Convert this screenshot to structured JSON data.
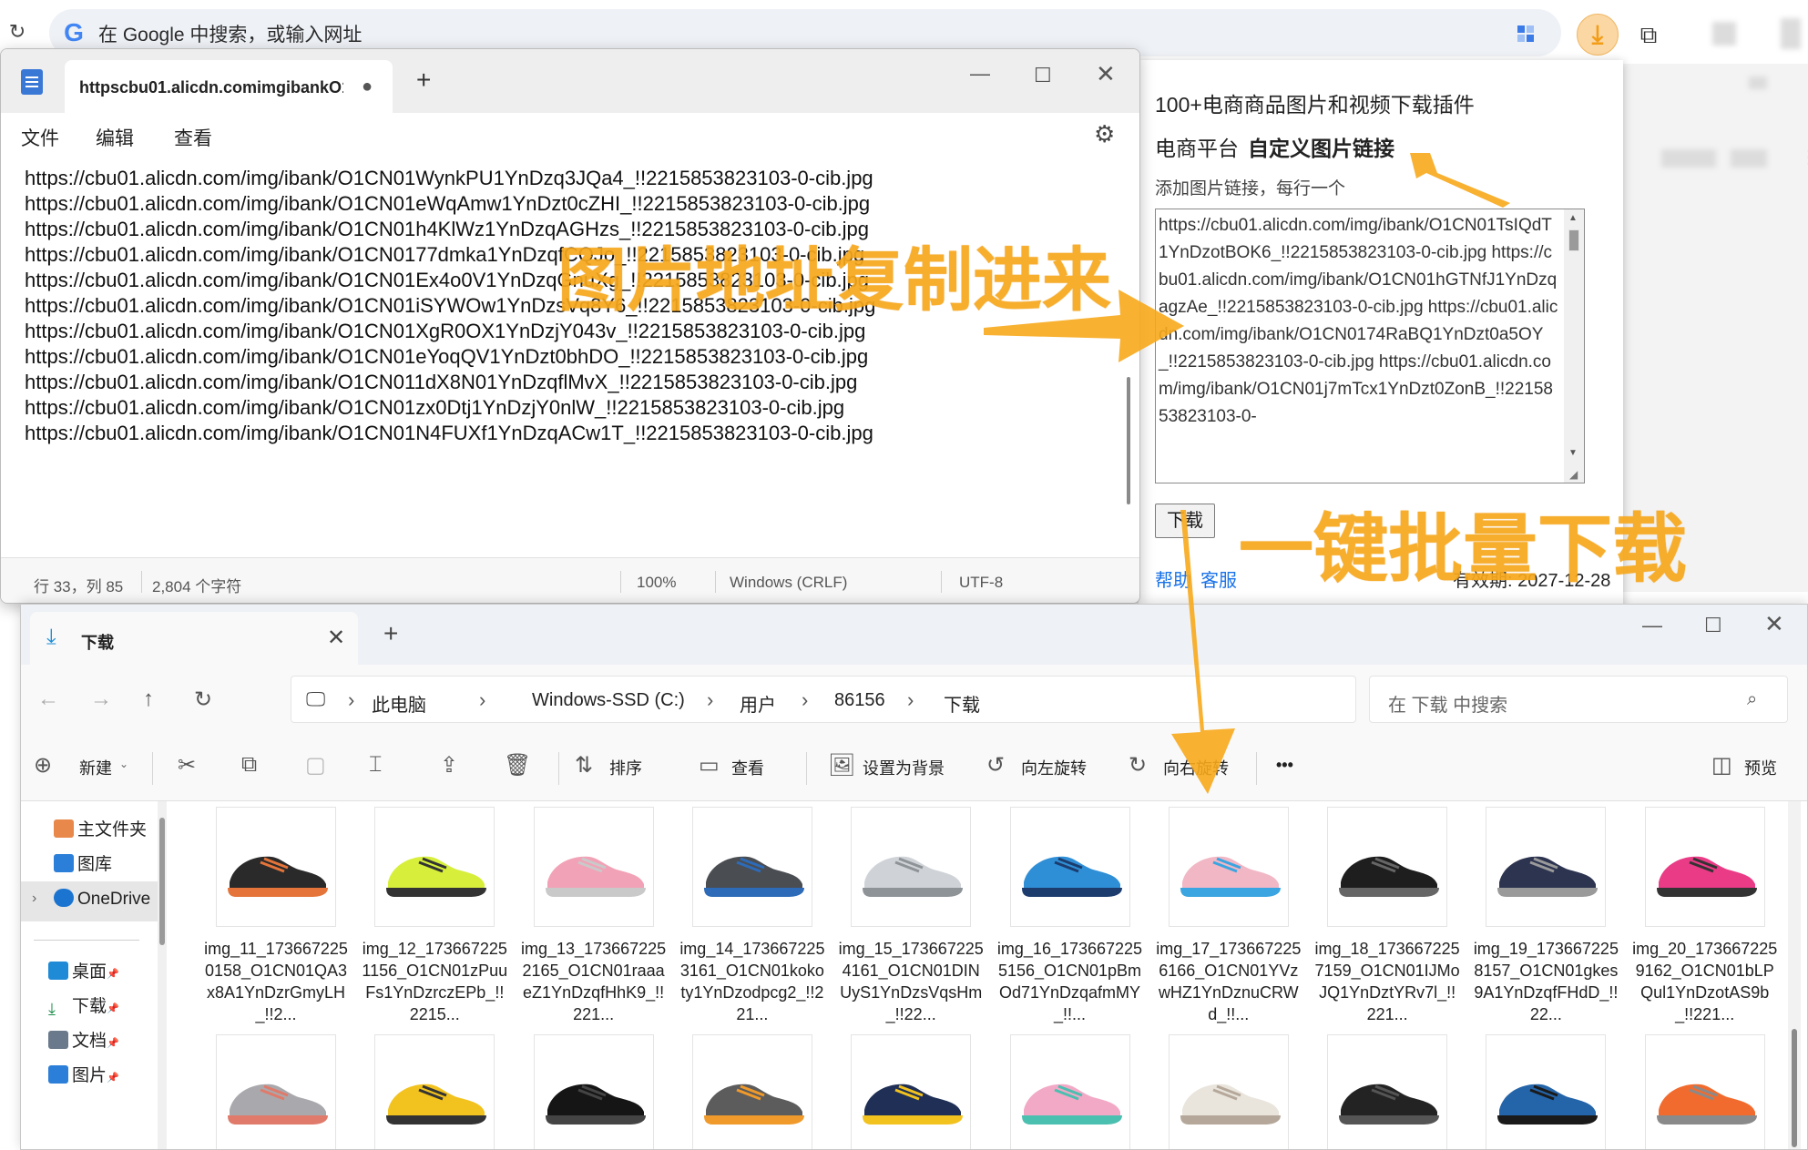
{
  "browser": {
    "omnibox_placeholder": "在 Google 中搜索，或输入网址",
    "google_logo": "G",
    "reload_glyph": "↻",
    "download_glyph": "⤓",
    "extensions_glyph": "⧉"
  },
  "popup": {
    "title": "100+电商商品图片和视频下载插件",
    "platform_label": "电商平台",
    "platform_value": "自定义图片链接",
    "hint": "添加图片链接，每行一个",
    "textarea_value": "https://cbu01.alicdn.com/img/ibank/O1CN01TsIQdT1YnDzotBOK6_!!2215853823103-0-cib.jpg\nhttps://cbu01.alicdn.com/img/ibank/O1CN01hGTNfJ1YnDzqagzAe_!!2215853823103-0-cib.jpg\nhttps://cbu01.alicdn.com/img/ibank/O1CN0174RaBQ1YnDzt0a5OY_!!2215853823103-0-cib.jpg\nhttps://cbu01.alicdn.com/img/ibank/O1CN01j7mTcx1YnDzt0ZonB_!!2215853823103-0-",
    "download_button": "下载",
    "help_link": "帮助",
    "service_link": "客服",
    "expiry": "有效期: 2027-12-28"
  },
  "notepad": {
    "tab_title": "httpscbu01.alicdn.comimgibankO1(",
    "tab_dot": "●",
    "newtab": "+",
    "window": {
      "min": "—",
      "max": "☐",
      "close": "✕"
    },
    "menu": {
      "file": "文件",
      "edit": "编辑",
      "view": "查看"
    },
    "gear": "⚙",
    "lines": [
      "https://cbu01.alicdn.com/img/ibank/O1CN01WynkPU1YnDzq3JQa4_!!2215853823103-0-cib.jpg",
      "https://cbu01.alicdn.com/img/ibank/O1CN01eWqAmw1YnDzt0cZHI_!!2215853823103-0-cib.jpg",
      "https://cbu01.alicdn.com/img/ibank/O1CN01h4KlWz1YnDzqAGHzs_!!2215853823103-0-cib.jpg",
      "https://cbu01.alicdn.com/img/ibank/O1CN0177dmka1YnDzqfCQJo_!!2215853823103-0-cib.jpg",
      "https://cbu01.alicdn.com/img/ibank/O1CN01Ex4o0V1YnDzqGnuXg_!!2215853823103-0-cib.jpg",
      "https://cbu01.alicdn.com/img/ibank/O1CN01iSYWOw1YnDzsVq8Y6_!!2215853823103-0-cib.jpg",
      "https://cbu01.alicdn.com/img/ibank/O1CN01XgR0OX1YnDzjY043v_!!2215853823103-0-cib.jpg",
      "https://cbu01.alicdn.com/img/ibank/O1CN01eYoqQV1YnDzt0bhDO_!!2215853823103-0-cib.jpg",
      "https://cbu01.alicdn.com/img/ibank/O1CN011dX8N01YnDzqflMvX_!!2215853823103-0-cib.jpg",
      "https://cbu01.alicdn.com/img/ibank/O1CN01zx0Dtj1YnDzjY0nlW_!!2215853823103-0-cib.jpg",
      "https://cbu01.alicdn.com/img/ibank/O1CN01N4FUXf1YnDzqACw1T_!!2215853823103-0-cib.jpg"
    ],
    "status": {
      "position": "行 33，列 85",
      "chars": "2,804 个字符",
      "zoom": "100%",
      "eol": "Windows (CRLF)",
      "encoding": "UTF-8"
    }
  },
  "explorer": {
    "tab_title": "下载",
    "tab_icon": "⤓",
    "tab_close": "✕",
    "newtab": "+",
    "window": {
      "min": "—",
      "max": "☐",
      "close": "✕"
    },
    "nav": {
      "back": "←",
      "forward": "→",
      "up": "↑",
      "refresh": "↻"
    },
    "pc_icon": "🖵",
    "breadcrumb": [
      "此电脑",
      "Windows-SSD (C:)",
      "用户",
      "86156",
      "下载"
    ],
    "search_placeholder": "在 下载 中搜索",
    "search_icon": "⌕",
    "toolbar": {
      "new": "新建",
      "sort": "排序",
      "view": "查看",
      "set_bg": "设置为背景",
      "rotate_left": "向左旋转",
      "rotate_right": "向右旋转",
      "more": "•••",
      "preview": "预览"
    },
    "sidebar": [
      {
        "label": "主文件夹",
        "icon": "home-icon"
      },
      {
        "label": "图库",
        "icon": "gallery-icon"
      },
      {
        "label": "OneDrive",
        "icon": "onedrive-icon"
      },
      {
        "label": "桌面",
        "icon": "desktop-icon"
      },
      {
        "label": "下载",
        "icon": "download-icon"
      },
      {
        "label": "文档",
        "icon": "document-icon"
      },
      {
        "label": "图片",
        "icon": "pictures-icon"
      }
    ],
    "pin_glyph": "📌",
    "files": [
      {
        "name": "img_11_1736672250158_O1CN01QA3x8A1YnDzrGmyLH_!!2...",
        "color": "#2a2a2a",
        "accent": "#e5743a"
      },
      {
        "name": "img_12_1736672251156_O1CN01zPuuFs1YnDzrczEPb_!!2215...",
        "color": "#d7ef3b",
        "accent": "#333333"
      },
      {
        "name": "img_13_1736672252165_O1CN01raaaeZ1YnDzqfHhK9_!!221...",
        "color": "#f2a2b6",
        "accent": "#c9c9c9"
      },
      {
        "name": "img_14_1736672253161_O1CN01kokoty1YnDzodpcg2_!!221...",
        "color": "#4a4d52",
        "accent": "#2d6bb8"
      },
      {
        "name": "img_15_1736672254161_O1CN01DINUyS1YnDzsVqsHm_!!22...",
        "color": "#cfd3d8",
        "accent": "#8e9398"
      },
      {
        "name": "img_16_1736672255156_O1CN01pBmOd71YnDzqafmMY_!!...",
        "color": "#2f8fd6",
        "accent": "#1c3c6e"
      },
      {
        "name": "img_17_1736672256166_O1CN01YVzwHZ1YnDznuCRWd_!!...",
        "color": "#f1b7c5",
        "accent": "#3aa5e0"
      },
      {
        "name": "img_18_1736672257159_O1CN01IJMoJQ1YnDztYRv7l_!!221...",
        "color": "#1e1e1e",
        "accent": "#666666"
      },
      {
        "name": "img_19_1736672258157_O1CN01gkes9A1YnDzqfFHdD_!!22...",
        "color": "#2c3450",
        "accent": "#9a9a9a"
      },
      {
        "name": "img_20_1736672259162_O1CN01bLPQul1YnDzotAS9b_!!221...",
        "color": "#ea3b86",
        "accent": "#333333"
      },
      {
        "name": "",
        "color": "#a9a9ad",
        "accent": "#e07a6a"
      },
      {
        "name": "",
        "color": "#f2c21e",
        "accent": "#333333"
      },
      {
        "name": "",
        "color": "#151515",
        "accent": "#444444"
      },
      {
        "name": "",
        "color": "#5c5c5c",
        "accent": "#f09a2b"
      },
      {
        "name": "",
        "color": "#1f2f55",
        "accent": "#f2c21e"
      },
      {
        "name": "",
        "color": "#f2a9c6",
        "accent": "#4bbfb0"
      },
      {
        "name": "",
        "color": "#e9e4dc",
        "accent": "#b5a89a"
      },
      {
        "name": "",
        "color": "#232323",
        "accent": "#555555"
      },
      {
        "name": "",
        "color": "#2464a8",
        "accent": "#1a1a1a"
      },
      {
        "name": "",
        "color": "#f26b2e",
        "accent": "#8a8a8a"
      }
    ]
  },
  "annotations": {
    "paste_urls": "图片地址复制进来",
    "one_click": "一键批量下载",
    "color": "#f7a81b"
  }
}
